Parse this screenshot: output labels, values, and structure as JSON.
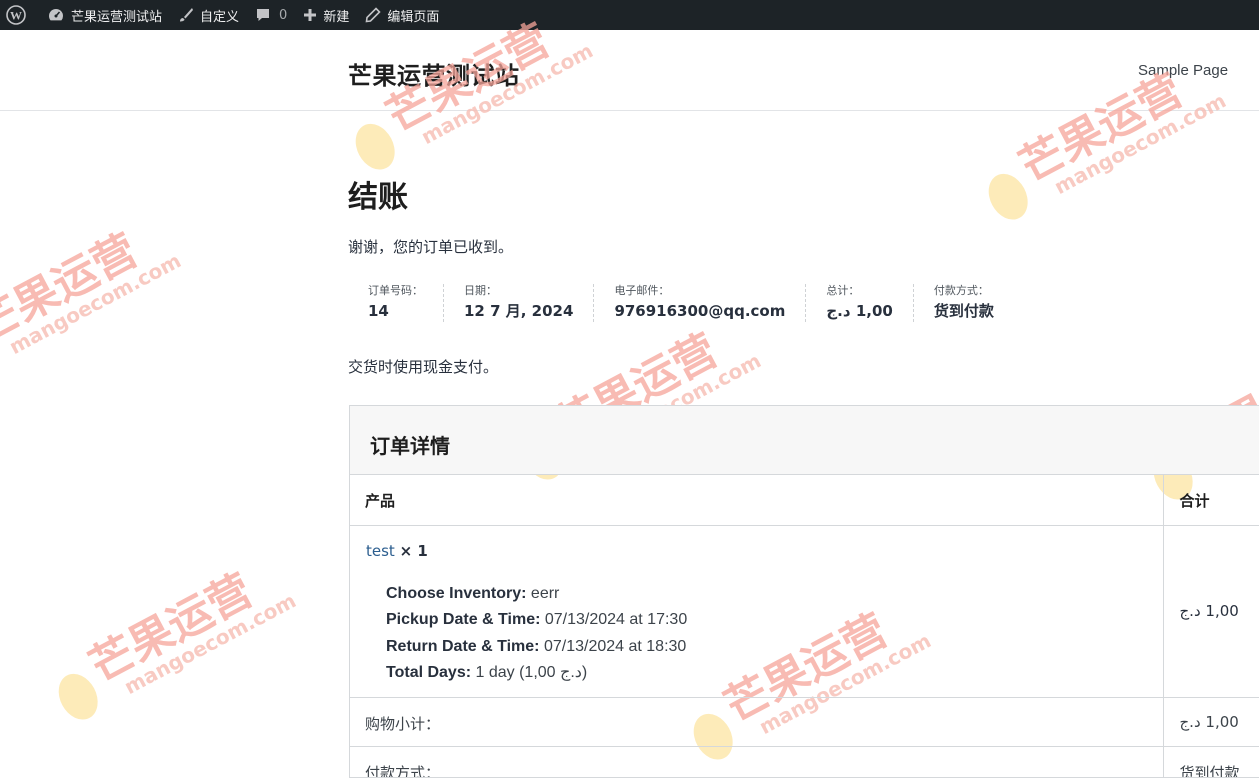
{
  "admin_bar": {
    "site_name": "芒果运营测试站",
    "customize": "自定义",
    "comments_count": "0",
    "new": "新建",
    "edit_page": "编辑页面"
  },
  "header": {
    "site_title": "芒果运营测试站",
    "nav_item": "Sample Page"
  },
  "page": {
    "title": "结账",
    "thanks": "谢谢，您的订单已收到。",
    "payment_note": "交货时使用现金支付。"
  },
  "overview": [
    {
      "label": "订单号码：",
      "value": "14"
    },
    {
      "label": "日期：",
      "value": "12 7 月, 2024"
    },
    {
      "label": "电子邮件：",
      "value": "976916300@qq.com"
    },
    {
      "label": "总计：",
      "value": "1,00 د.ج"
    },
    {
      "label": "付款方式：",
      "value": "货到付款"
    }
  ],
  "order_details": {
    "heading": "订单详情",
    "col_product": "产品",
    "col_total": "合计",
    "item": {
      "name": "test",
      "qty": "× 1",
      "total": "1,00 د.ج",
      "meta": [
        {
          "key": "Choose Inventory:",
          "value": " eerr"
        },
        {
          "key": "Pickup Date & Time:",
          "value": " 07/13/2024 at 17:30"
        },
        {
          "key": "Return Date & Time:",
          "value": " 07/13/2024 at 18:30"
        },
        {
          "key": "Total Days:",
          "value": " 1 day (1,00 د.ج)"
        }
      ]
    },
    "subtotal_label": "购物小计：",
    "subtotal_value": "1,00 د.ج",
    "payment_label": "付款方式：",
    "payment_value": "货到付款"
  },
  "watermark": {
    "main": "芒果运营",
    "sub": "mangoecom.com"
  },
  "colors": {
    "admin_bar_bg": "#1d2327",
    "link": "#2c5e8f",
    "watermark": "#f6a59a"
  }
}
